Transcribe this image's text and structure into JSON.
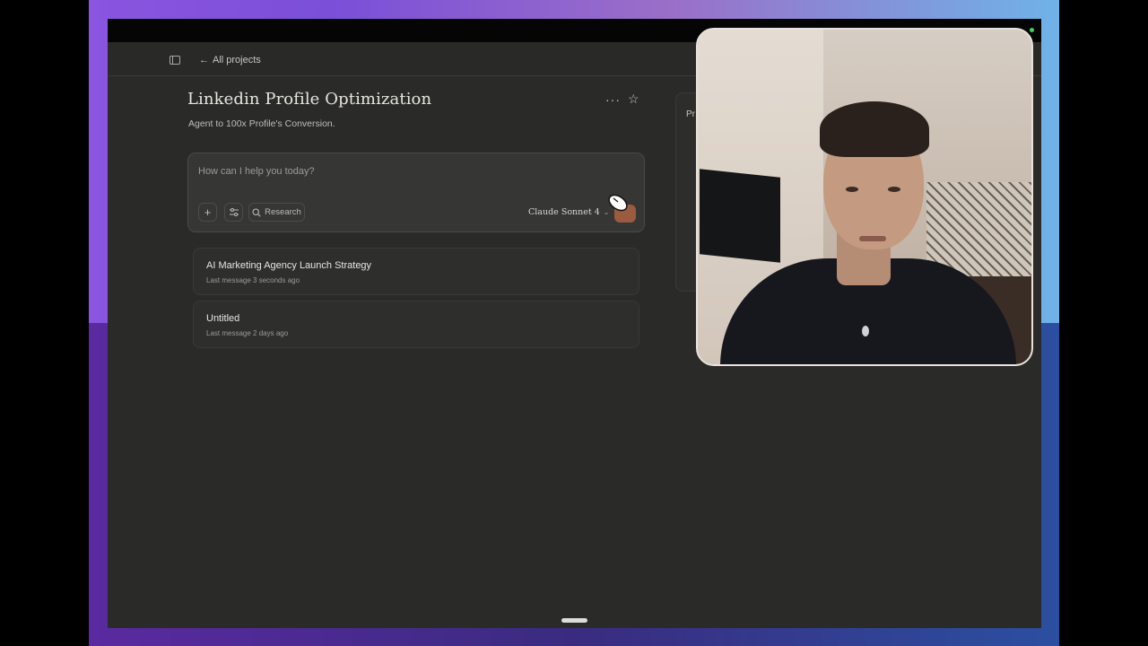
{
  "nav": {
    "back_label": "All projects"
  },
  "project": {
    "title": "Linkedin Profile Optimization",
    "subtitle": "Agent to 100x Profile's Conversion."
  },
  "composer": {
    "placeholder": "How can I help you today?",
    "research_label": "Research",
    "model": "Claude Sonnet 4"
  },
  "chats": [
    {
      "title": "AI Marketing Agency Launch Strategy",
      "meta": "Last message 3 seconds ago"
    },
    {
      "title": "Untitled",
      "meta": "Last message 2 days ago"
    }
  ],
  "side_panel": {
    "label": "Pr"
  },
  "colors": {
    "accent": "#9c5a3e",
    "background": "#2a2a29",
    "status_dot": "#3fcf5a"
  },
  "icons": [
    "sidebar-toggle-icon",
    "back-arrow-icon",
    "more-icon",
    "star-icon",
    "plus-icon",
    "sliders-icon",
    "search-icon",
    "chevron-down-icon",
    "mouse-cursor-icon"
  ]
}
